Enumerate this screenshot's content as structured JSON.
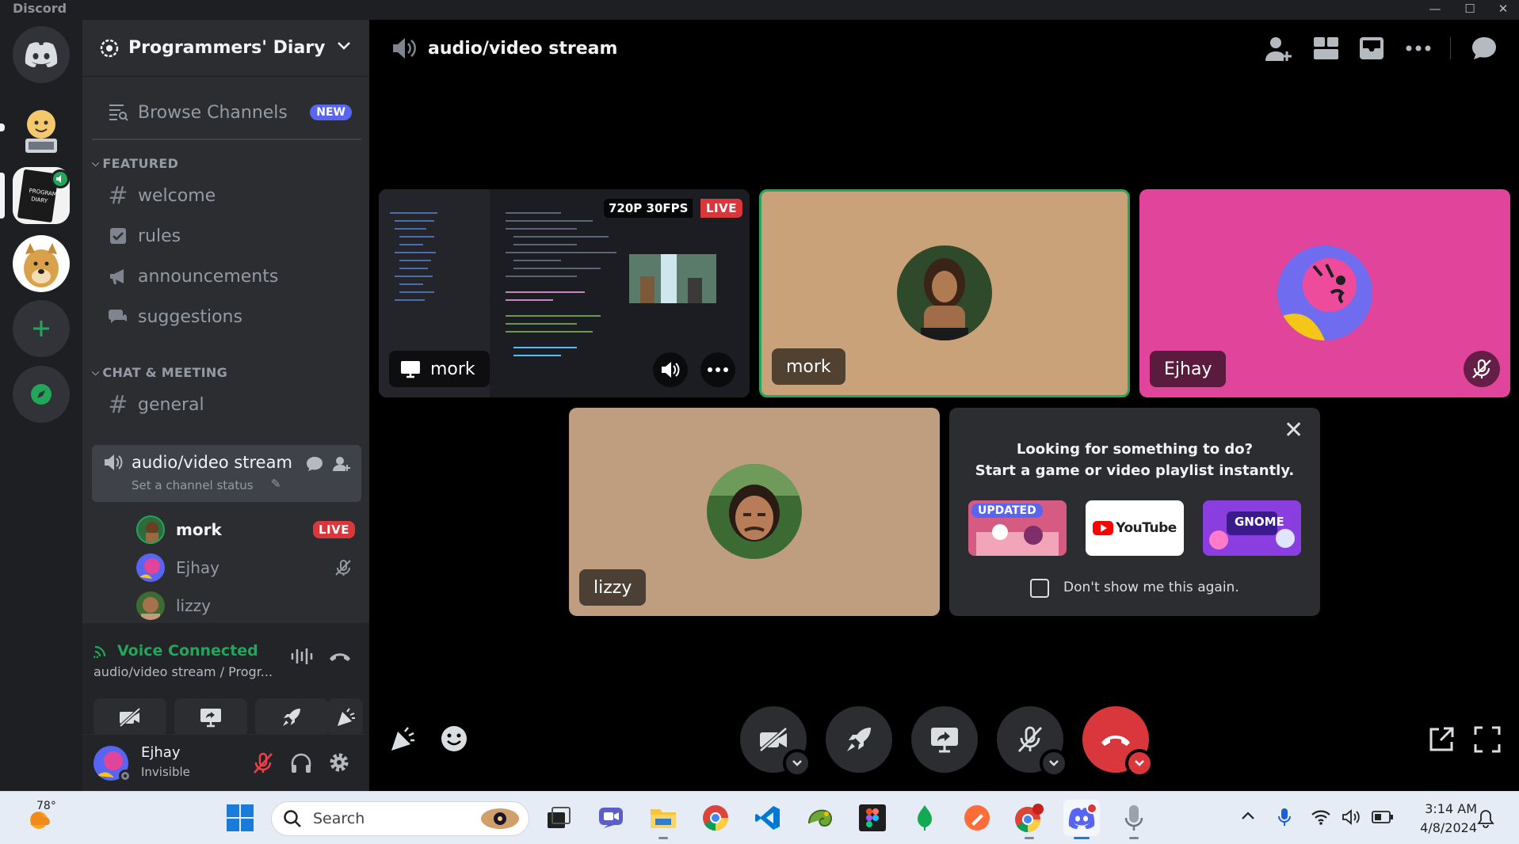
{
  "window": {
    "app_name": "Discord",
    "minimize": "—",
    "maximize": "☐",
    "close": "✕"
  },
  "server": {
    "name": "Programmers' Diary"
  },
  "sidebar": {
    "browse_channels": "Browse Channels",
    "new_badge": "NEW",
    "categories": [
      {
        "name": "FEATURED",
        "channels": [
          {
            "name": "welcome",
            "icon": "hash-icon"
          },
          {
            "name": "rules",
            "icon": "rules-checkbox-icon"
          },
          {
            "name": "announcements",
            "icon": "megaphone-icon"
          },
          {
            "name": "suggestions",
            "icon": "forum-bubble-icon"
          }
        ]
      },
      {
        "name": "CHAT & MEETING",
        "channels": [
          {
            "name": "general",
            "icon": "hash-icon"
          },
          {
            "name": "audio/video stream",
            "icon": "speaker-icon",
            "status_placeholder": "Set a channel status"
          }
        ]
      }
    ],
    "voice_users": [
      {
        "name": "mork",
        "badge": "LIVE"
      },
      {
        "name": "Ejhay",
        "muted": true
      },
      {
        "name": "lizzy"
      }
    ]
  },
  "voice_panel": {
    "status": "Voice Connected",
    "location": "audio/video stream / Progr..."
  },
  "user": {
    "name": "Ejhay",
    "status": "Invisible"
  },
  "main": {
    "channel_title": "audio/video stream",
    "stream": {
      "quality": "720P 30FPS",
      "live": "LIVE",
      "user": "mork"
    },
    "tiles": [
      {
        "name": "mork",
        "bg": "#c9a27a",
        "speaking": true
      },
      {
        "name": "Ejhay",
        "bg": "#e0449b",
        "muted": true
      },
      {
        "name": "lizzy",
        "bg": "#bf9e7f"
      }
    ],
    "activity": {
      "line1": "Looking for something to do?",
      "line2": "Start a game or video playlist instantly.",
      "updated_badge": "UPDATED",
      "youtube_label": "YouTube",
      "gnome_label": "GNOME",
      "dont_show": "Don't show me this again."
    }
  },
  "colors": {
    "accent": "#5865f2",
    "green": "#23a55a",
    "red": "#da373c",
    "pink": "#e0449b"
  },
  "taskbar": {
    "weather": "78°",
    "search_placeholder": "Search",
    "time": "3:14 AM",
    "date": "4/8/2024",
    "icons": [
      "windows-start-icon",
      "search-icon",
      "task-view-icon",
      "meet-icon",
      "file-explorer-icon",
      "chrome-icon",
      "vscode-icon",
      "chameleon-app-icon",
      "figma-icon",
      "mongodb-icon",
      "postman-icon",
      "chrome-profile-icon",
      "discord-icon",
      "voice-recorder-icon"
    ]
  }
}
